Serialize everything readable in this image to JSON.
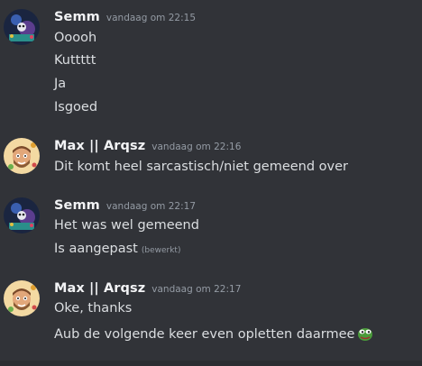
{
  "messages": [
    {
      "author": "Semm",
      "timestamp": "vandaag om 22:15",
      "avatar": "semm-avatar",
      "lines": [
        "Ooooh",
        "Kuttttt",
        "Ja",
        "Isgoed"
      ]
    },
    {
      "author": "Max || Arqsz",
      "timestamp": "vandaag om 22:16",
      "avatar": "max-avatar",
      "lines": [
        "Dit komt heel sarcastisch/niet gemeend over"
      ]
    },
    {
      "author": "Semm",
      "timestamp": "vandaag om 22:17",
      "avatar": "semm-avatar",
      "lines": [
        "Het was wel gemeend",
        "Is aangepast"
      ],
      "edited_label": "(bewerkt)"
    },
    {
      "author": "Max || Arqsz",
      "timestamp": "vandaag om 22:17",
      "avatar": "max-avatar",
      "lines": [
        "Oke, thanks",
        "Aub de volgende keer even opletten daarmee"
      ],
      "emoji": "pepe-frog-emoji"
    }
  ],
  "colors": {
    "background": "#313338",
    "author": "#f2f3f5",
    "timestamp": "#949ba4",
    "text": "#dbdee1"
  }
}
